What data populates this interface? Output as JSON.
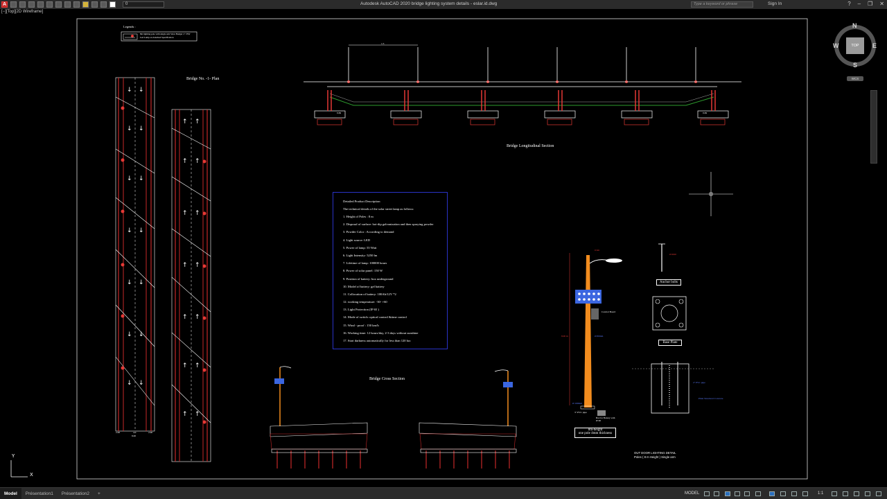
{
  "window": {
    "app_title": "Autodesk AutoCAD 2020   bridge lighting system details - eslar.id.dwg",
    "layer_value": "0",
    "search_placeholder": "Type a keyword or phrase",
    "sign_in": "Sign In",
    "help": "?"
  },
  "viewport": {
    "label": "[−][Top][2D Wireframe]"
  },
  "viewcube": {
    "north": "N",
    "south": "S",
    "east": "E",
    "west": "W",
    "face": "TOP",
    "wcs": "WCS"
  },
  "drawing": {
    "legend_title": "Legends :",
    "legend_text": [
      "8m lighting pole with single arm Solar Budget 1^ 55W",
      "Led Lamp on Attached Specification"
    ],
    "plan_title": "Bridge No. -1- Plan",
    "long_title": "Bridge Longitudinal Section",
    "cross_title": "Bridge Cross Section",
    "long_dim": "1.5",
    "long_pier_dim_left": "0.69",
    "long_pier_dim_right": "0.69",
    "plan_dims": [
      "2.00",
      "4.0",
      "2.00"
    ],
    "plan_total": "8.00",
    "spec": {
      "title": "Detailed Product Description",
      "intro": "The technical details of the solar street lamp as follows:",
      "items": [
        "1. Height of Poles : 8 m",
        "2. Disposal of surface: hot-dip galvanization and then spraying powder",
        "3. Powder Color : According to demand",
        "4. Light source: LED",
        "5. Power of lamp: 55 Watt",
        "6. Light Intensity: 5250 lm",
        "7. Lifetime of lamp: 100000 hours",
        "8. Power of solar panel: 150 W",
        "9. Position of battery: box underground",
        "10. Model of battery: gel battery",
        "11. Collocation of battery: 100Ah/12V *2",
        "12. working temperature: -30- +60",
        "13. Light Protection (IP 65 )",
        "14. Mode of switch: optical control &time control",
        "15. Wind - proof : 150 km/h",
        "16. Working time: 12 hours/day, 2-3 days without sunshine",
        "17. Start darkness automatically for less than 120 lux"
      ]
    },
    "pole_caption": [
      "8m-height",
      "one pole 4mm thickness"
    ],
    "pole_labels": {
      "top_dim": "0.5m",
      "control_board": "Control Board",
      "pole_dia": "Ø 80mm",
      "base_dia": "Ø 160mm",
      "pipe": "3\" PVC pipe",
      "battery_box": "Box for Battery with IP 68",
      "height": "8.00 m"
    },
    "anchor_label": "Anchor bolts",
    "anchor_dim": "Ø M20",
    "base_label": "Base Plate",
    "foundation_labels": [
      "2\" PVC pipe",
      "Plain Structural Concrete"
    ],
    "outdoor_title": "OUT DOOR LIGHTING DETAIL",
    "outdoor_subtitle": "Poles ( 8 m Height ) Single arm",
    "ucs_y": "Y",
    "ucs_x": "X"
  },
  "tabs": [
    {
      "label": "Model",
      "active": true
    },
    {
      "label": "Présentation1",
      "active": false
    },
    {
      "label": "Présentation2",
      "active": false
    },
    {
      "label": "+",
      "active": false
    }
  ],
  "status": {
    "model": "MODEL",
    "scale": "1:1"
  },
  "colors": {
    "pole_orange": "#f28c1e",
    "lamp_red": "#e53935",
    "spec_border": "#2a33c8",
    "ground_green": "#2e9e2e"
  }
}
